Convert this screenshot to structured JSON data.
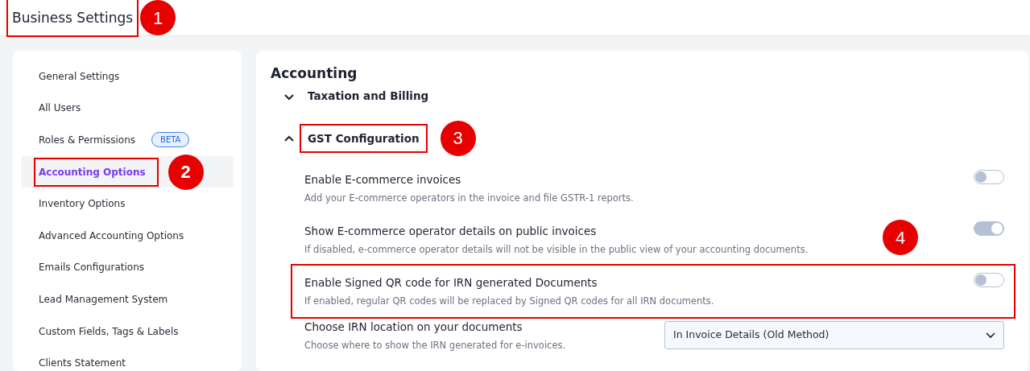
{
  "header": {
    "title": "Business Settings",
    "highlighted": true,
    "callout": "1"
  },
  "sidebar": {
    "items": [
      {
        "label": "General Settings",
        "selected": false
      },
      {
        "label": "All Users",
        "selected": false
      },
      {
        "label": "Roles & Permissions",
        "badge": "BETA",
        "selected": false
      },
      {
        "label": "Accounting Options",
        "selected": true,
        "highlighted": true,
        "callout": "2"
      },
      {
        "label": "Inventory Options",
        "selected": false
      },
      {
        "label": "Advanced Accounting Options",
        "selected": false
      },
      {
        "label": "Emails Configurations",
        "selected": false
      },
      {
        "label": "Lead Management System",
        "selected": false
      },
      {
        "label": "Custom Fields, Tags & Labels",
        "selected": false
      },
      {
        "label": "Clients Statement",
        "selected": false
      }
    ]
  },
  "main": {
    "title": "Accounting",
    "sections": [
      {
        "title": "Taxation and Billing",
        "expanded": false
      },
      {
        "title": "GST Configuration",
        "expanded": true,
        "highlighted": true,
        "callout": "3",
        "settings": [
          {
            "kind": "toggle",
            "title": "Enable E-commerce invoices",
            "description": "Add your E-commerce operators in the invoice and file GSTR-1 reports.",
            "on": false
          },
          {
            "kind": "toggle",
            "title": "Show E-commerce operator details on public invoices",
            "description": "If disabled, e-commerce operator details will not be visible in the public view of your accounting documents.",
            "on": true
          },
          {
            "kind": "toggle",
            "title": "Enable Signed QR code for IRN generated Documents",
            "description": "If enabled, regular QR codes will be replaced by Signed QR codes for all IRN documents.",
            "on": false,
            "highlighted": true,
            "callout": "4"
          },
          {
            "kind": "select",
            "title": "Choose IRN location on your documents",
            "description": "Choose where to show the IRN generated for e-invoices.",
            "value": "In Invoice Details (Old Method)"
          }
        ]
      }
    ]
  }
}
